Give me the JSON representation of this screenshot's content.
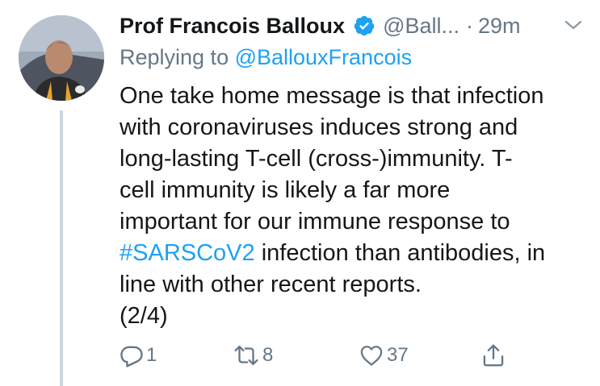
{
  "tweet": {
    "author_name": "Prof Francois Balloux",
    "handle": "@Ball...",
    "separator": "·",
    "time": "29m",
    "replying_prefix": "Replying to ",
    "replying_to": "@BallouxFrancois",
    "text_lines": [
      "One take home message is that infection",
      "with coronaviruses induces strong and",
      "long-lasting T-cell (cross-)immunity. T-",
      "cell immunity is likely a far more",
      "important for our immune response to"
    ],
    "hashtag": "#SARSCoV2",
    "line6_rest": " infection than antibodies, in",
    "line7": "line with other recent reports.",
    "line8": "(2/4)"
  },
  "actions": {
    "reply_icon": "reply-icon",
    "reply_count": "1",
    "retweet_icon": "retweet-icon",
    "retweet_count": "8",
    "like_icon": "heart-icon",
    "like_count": "37",
    "share_icon": "share-icon"
  },
  "colors": {
    "text": "#14171a",
    "secondary": "#657786",
    "link": "#1da1f2",
    "verified": "#1da1f2",
    "thread_line": "#ccd6dd"
  }
}
